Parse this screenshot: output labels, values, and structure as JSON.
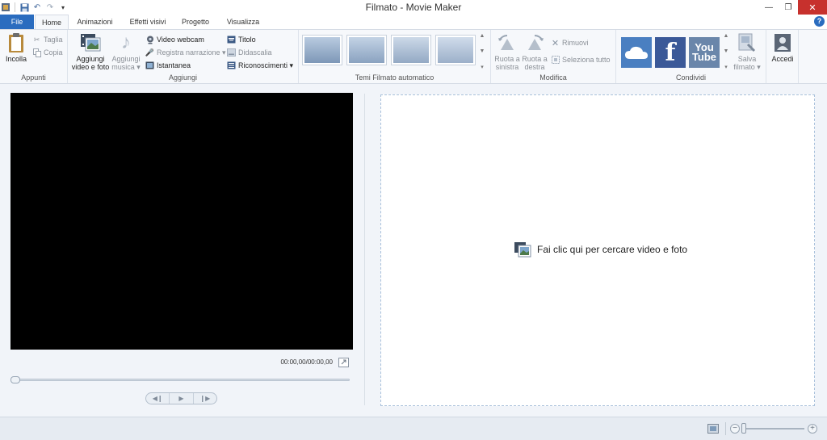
{
  "window": {
    "title": "Filmato - Movie Maker",
    "minimize": "—",
    "restore": "❐",
    "close": "✕"
  },
  "tabs": {
    "file": "File",
    "home": "Home",
    "animazioni": "Animazioni",
    "effetti": "Effetti visivi",
    "progetto": "Progetto",
    "visualizza": "Visualizza"
  },
  "ribbon": {
    "appunti": {
      "label": "Appunti",
      "incolla": "Incolla",
      "taglia": "Taglia",
      "copia": "Copia"
    },
    "aggiungi": {
      "label": "Aggiungi",
      "video_line1": "Aggiungi",
      "video_line2": "video e foto",
      "musica_line1": "Aggiungi",
      "musica_line2": "musica ▾",
      "webcam": "Video webcam",
      "narrazione": "Registra narrazione ▾",
      "istantanea": "Istantanea",
      "titolo": "Titolo",
      "didascalia": "Didascalia",
      "riconoscimenti": "Riconoscimenti ▾"
    },
    "temi": {
      "label": "Temi Filmato automatico"
    },
    "modifica": {
      "label": "Modifica",
      "ruota_sx_line1": "Ruota a",
      "ruota_sx_line2": "sinistra",
      "ruota_dx_line1": "Ruota a",
      "ruota_dx_line2": "destra",
      "rimuovi": "Rimuovi",
      "seleziona": "Seleziona tutto"
    },
    "condividi": {
      "label": "Condividi",
      "youtube_line1": "You",
      "youtube_line2": "Tube",
      "salva_line1": "Salva",
      "salva_line2": "filmato ▾"
    },
    "accedi": "Accedi"
  },
  "preview": {
    "timecode": "00:00,00/00:00,00"
  },
  "storyboard": {
    "message": "Fai clic qui per cercare video e foto"
  },
  "colors": {
    "file_tab": "#2a6cbf",
    "close_button": "#c7312d",
    "onedrive": "#4a7fc1",
    "facebook": "#3b5998",
    "youtube": "#6a86aa"
  }
}
